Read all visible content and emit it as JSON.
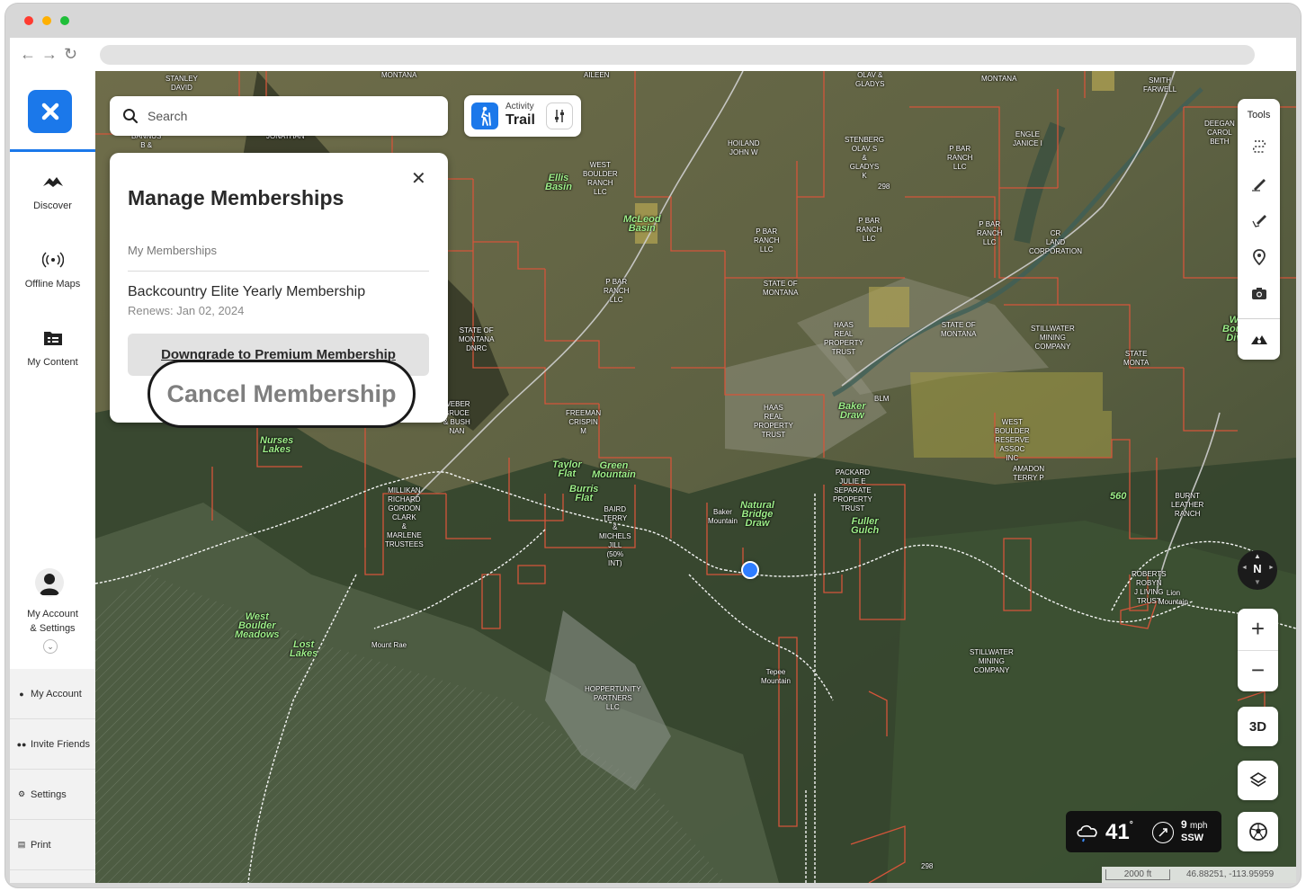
{
  "sidebar": {
    "items": [
      {
        "label": "Discover",
        "icon": "discover-icon"
      },
      {
        "label": "Offline Maps",
        "icon": "offline-maps-icon"
      },
      {
        "label": "My Content",
        "icon": "my-content-icon"
      }
    ],
    "account_label_line1": "My Account",
    "account_label_line2": "& Settings",
    "bottom": [
      {
        "label": "My Account",
        "icon": "person-icon"
      },
      {
        "label": "Invite Friends",
        "icon": "people-icon"
      },
      {
        "label": "Settings",
        "icon": "gear-icon"
      },
      {
        "label": "Print",
        "icon": "printer-icon"
      }
    ]
  },
  "search": {
    "placeholder": "Search"
  },
  "activity": {
    "label": "Activity",
    "value": "Trail"
  },
  "membership_panel": {
    "title": "Manage Memberships",
    "section": "My Memberships",
    "membership_name": "Backcountry Elite Yearly Membership",
    "renews": "Renews: Jan 02, 2024",
    "downgrade_label": "Downgrade to Premium Membership",
    "cancel_label": "Cancel Membership"
  },
  "tools": {
    "label": "Tools"
  },
  "compass": {
    "label": "N"
  },
  "zoom": {
    "in": "+",
    "out": "−"
  },
  "three_d": "3D",
  "weather": {
    "temp": "41",
    "degree": "°",
    "wind_speed": "9",
    "wind_unit": "mph",
    "wind_dir": "SSW"
  },
  "scale": "2000 ft",
  "coordinates": "46.88251, -113.95959",
  "map_labels": [
    {
      "t": "STANLEY\nDAVID",
      "g": "small"
    },
    {
      "t": "MONTANA",
      "g": "small"
    },
    {
      "t": "AILEEN",
      "g": "small"
    },
    {
      "t": "OLAV &\nGLADYS",
      "g": "small"
    },
    {
      "t": "MONTANA",
      "g": "small"
    },
    {
      "t": "SMITH\nFARWELL",
      "g": "small"
    },
    {
      "t": "JONATHAN",
      "g": "small"
    },
    {
      "t": "BANNUS\nB &",
      "g": "small"
    },
    {
      "t": "HOILAND\nJOHN W",
      "g": "small"
    },
    {
      "t": "STENBERG\nOLAV S\n&\nGLADYS\nK",
      "g": "small"
    },
    {
      "t": "P BAR\nRANCH\nLLC",
      "g": "small"
    },
    {
      "t": "ENGLE\nJANICE I",
      "g": "small"
    },
    {
      "t": "DEEGAN\nCAROL\nBETH",
      "g": "small"
    },
    {
      "t": "WEST\nBOULDER\nRANCH\nLLC",
      "g": "small"
    },
    {
      "t": "Ellis\nBasin",
      "g": "green"
    },
    {
      "t": "McLeod\nBasin",
      "g": "green"
    },
    {
      "t": "P BAR\nRANCH\nLLC",
      "g": "small"
    },
    {
      "t": "P BAR\nRANCH\nLLC",
      "g": "small"
    },
    {
      "t": "P BAR\nRANCH\nLLC",
      "g": "small"
    },
    {
      "t": "CR\nLAND\nCORPORATION",
      "g": "small"
    },
    {
      "t": "P BAR\nRANCH\nLLC",
      "g": "small"
    },
    {
      "t": "STATE OF\nMONTANA",
      "g": "small"
    },
    {
      "t": "HAAS\nREAL\nPROPERTY\nTRUST",
      "g": "small"
    },
    {
      "t": "STATE OF\nMONTANA",
      "g": "small"
    },
    {
      "t": "STILLWATER\nMINING\nCOMPANY",
      "g": "small"
    },
    {
      "t": "STATE\nMONTA",
      "g": "small"
    },
    {
      "t": "West\nBoulder\nDivide",
      "g": "green"
    },
    {
      "t": "STATE OF\nMONTANA\nDNRC",
      "g": "small"
    },
    {
      "t": "HAAS\nREAL\nPROPERTY\nTRUST",
      "g": "small"
    },
    {
      "t": "Baker\nDraw",
      "g": "green"
    },
    {
      "t": "BLM",
      "g": "small"
    },
    {
      "t": "WEST\nBOULDER\nRESERVE\nASSOC\nINC",
      "g": "small"
    },
    {
      "t": "WEBER\nBRUCE\n& BUSH\nNAN",
      "g": "small"
    },
    {
      "t": "FREEMAN\nCRISPIN\nM",
      "g": "small"
    },
    {
      "t": "Nurses\nLakes",
      "g": "green"
    },
    {
      "t": "Taylor\nFlat",
      "g": "green"
    },
    {
      "t": "Green\nMountain",
      "g": "green"
    },
    {
      "t": "AMADON\nTERRY P",
      "g": "small"
    },
    {
      "t": "560",
      "g": "green"
    },
    {
      "t": "BURNT\nLEATHER\nRANCH",
      "g": "small"
    },
    {
      "t": "MILLIKAN\nRICHARD\nGORDON\nCLARK\n&\nMARLENE\nTRUSTEES",
      "g": "small"
    },
    {
      "t": "Burris\nFlat",
      "g": "green"
    },
    {
      "t": "BAIRD\nTERRY\n&\nMICHELS\nJILL\n(50%\nINT)",
      "g": "small"
    },
    {
      "t": "Baker\nMountain",
      "g": "small"
    },
    {
      "t": "Natural\nBridge\nDraw",
      "g": "green"
    },
    {
      "t": "PACKARD\nJULIE E\nSEPARATE\nPROPERTY\nTRUST",
      "g": "small"
    },
    {
      "t": "Fuller\nGulch",
      "g": "green"
    },
    {
      "t": "ROBERTS\nROBYN\nJ LIVING\nTRUST",
      "g": "small"
    },
    {
      "t": "Lion\nMountain",
      "g": "small"
    },
    {
      "t": "West\nBoulder\nMeadows",
      "g": "green"
    },
    {
      "t": "Lost\nLakes",
      "g": "green"
    },
    {
      "t": "Mount Rae",
      "g": "small"
    },
    {
      "t": "HOPPERTUNITY\nPARTNERS\nLLC",
      "g": "small"
    },
    {
      "t": "Tepee\nMountain",
      "g": "small"
    },
    {
      "t": "STILLWATER\nMINING\nCOMPANY",
      "g": "small"
    },
    {
      "t": "298",
      "g": "small"
    },
    {
      "t": "298",
      "g": "small"
    }
  ]
}
